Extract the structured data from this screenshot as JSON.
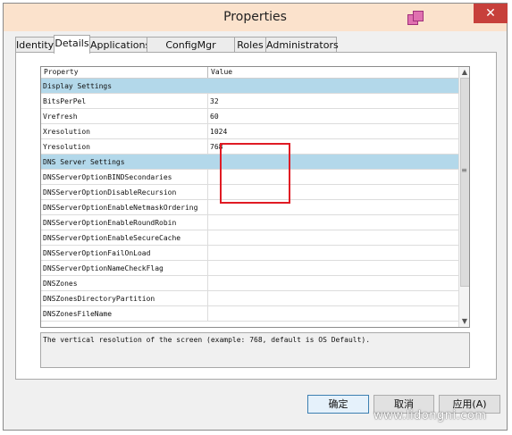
{
  "window": {
    "title": "Properties",
    "close_symbol": "✕"
  },
  "tabs": [
    {
      "label": "Identity"
    },
    {
      "label": "Details"
    },
    {
      "label": "Applications"
    },
    {
      "label": "ConfigMgr Packages"
    },
    {
      "label": "Roles"
    },
    {
      "label": "Administrators"
    }
  ],
  "active_tab": "Details",
  "grid": {
    "headers": {
      "property": "Property",
      "value": "Value"
    },
    "rows": [
      {
        "name": "Display Settings",
        "value": "",
        "category": true
      },
      {
        "name": "BitsPerPel",
        "value": "32"
      },
      {
        "name": "Vrefresh",
        "value": "60"
      },
      {
        "name": "Xresolution",
        "value": "1024"
      },
      {
        "name": "Yresolution",
        "value": "768"
      },
      {
        "name": "DNS Server Settings",
        "value": "",
        "category": true
      },
      {
        "name": "DNSServerOptionBINDSecondaries",
        "value": ""
      },
      {
        "name": "DNSServerOptionDisableRecursion",
        "value": ""
      },
      {
        "name": "DNSServerOptionEnableNetmaskOrdering",
        "value": ""
      },
      {
        "name": "DNSServerOptionEnableRoundRobin",
        "value": ""
      },
      {
        "name": "DNSServerOptionEnableSecureCache",
        "value": ""
      },
      {
        "name": "DNSServerOptionFailOnLoad",
        "value": ""
      },
      {
        "name": "DNSServerOptionNameCheckFlag",
        "value": ""
      },
      {
        "name": "DNSZones",
        "value": ""
      },
      {
        "name": "DNSZonesDirectoryPartition",
        "value": ""
      },
      {
        "name": "DNSZonesFileName",
        "value": ""
      }
    ],
    "scrollbar": {
      "up": "▲",
      "down": "▼",
      "grip": "≡"
    }
  },
  "description": "The vertical resolution of the screen (example: 768, default is OS Default).",
  "buttons": {
    "ok": "确定",
    "cancel": "取消",
    "apply": "应用(A)"
  },
  "watermark": "www.lidongni.com",
  "colors": {
    "titlebar": "#fbe2cc",
    "category_row": "#b3d8ea",
    "highlight": "#e01b24",
    "close": "#c7403b"
  }
}
